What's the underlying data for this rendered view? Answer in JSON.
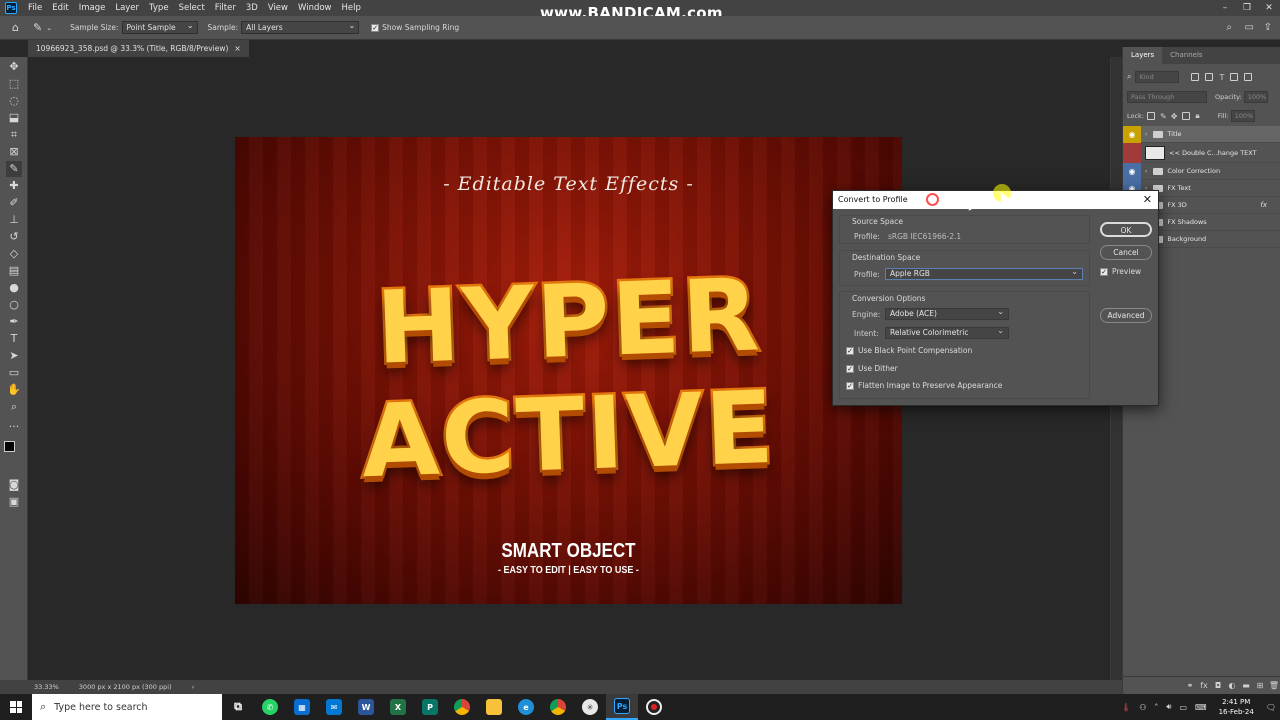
{
  "app": {
    "logo": "Ps",
    "menu": [
      "File",
      "Edit",
      "Image",
      "Layer",
      "Type",
      "Select",
      "Filter",
      "3D",
      "View",
      "Window",
      "Help"
    ],
    "watermark": "www.BANDICAM.com"
  },
  "options_bar": {
    "sample_size_label": "Sample Size:",
    "sample_size_value": "Point Sample",
    "sample_label": "Sample:",
    "sample_value": "All Layers",
    "show_ring_label": "Show Sampling Ring"
  },
  "document": {
    "tab_title": "10966923_358.psd @ 33.3% (Title, RGB/8/Preview)",
    "tab_close": "×",
    "zoom": "33.33%",
    "dimensions": "3000 px x 2100 px (300 ppi)"
  },
  "artwork": {
    "tagline": "- Editable Text Effects -",
    "line1": "HYPER",
    "line2": "ACTIVE",
    "smart_title": "SMART OBJECT",
    "smart_subtitle": "- EASY TO EDIT | EASY TO USE -"
  },
  "layers_panel": {
    "tabs": [
      "Layers",
      "Channels"
    ],
    "search_placeholder": "Kind",
    "blend_mode": "Pass Through",
    "opacity_label": "Opacity:",
    "opacity_value": "100%",
    "lock_label": "Lock:",
    "fill_label": "Fill:",
    "fill_value": "100%",
    "layers": [
      {
        "name": "Title",
        "type": "group",
        "visible": true,
        "selected": true
      },
      {
        "name": "<< Double C...hange TEXT",
        "type": "smart",
        "visible": false
      },
      {
        "name": "Color Correction",
        "type": "group",
        "visible": true
      },
      {
        "name": "FX Text",
        "type": "group",
        "visible": true
      },
      {
        "name": "FX 3D",
        "type": "group",
        "visible": true,
        "fx": "fx"
      },
      {
        "name": "FX Shadows",
        "type": "group",
        "visible": false
      },
      {
        "name": "Background",
        "type": "group",
        "visible": false
      }
    ]
  },
  "dialog": {
    "title": "Convert to Profile",
    "close": "✕",
    "source_space_title": "Source Space",
    "source_profile_label": "Profile:",
    "source_profile_value": "sRGB IEC61966-2.1",
    "dest_space_title": "Destination Space",
    "dest_profile_label": "Profile:",
    "dest_profile_value": "Apple RGB",
    "conversion_title": "Conversion Options",
    "engine_label": "Engine:",
    "engine_value": "Adobe (ACE)",
    "intent_label": "Intent:",
    "intent_value": "Relative Colorimetric",
    "checkboxes": [
      {
        "label": "Use Black Point Compensation",
        "checked": true
      },
      {
        "label": "Use Dither",
        "checked": true
      },
      {
        "label": "Flatten Image to Preserve Appearance",
        "checked": true
      }
    ],
    "ok_label": "OK",
    "cancel_label": "Cancel",
    "preview_label": "Preview",
    "advanced_label": "Advanced"
  },
  "taskbar": {
    "search_placeholder": "Type here to search",
    "time": "2:41 PM",
    "date": "16-Feb-24"
  },
  "colors": {
    "photoshop_blue": "#31a8ff",
    "highlight_yellow": "#ffff00",
    "layer_eye_selected": "#c8a200",
    "layer_eye_blue": "#4a6fa5",
    "layer_eye_red": "#a33a3a"
  }
}
